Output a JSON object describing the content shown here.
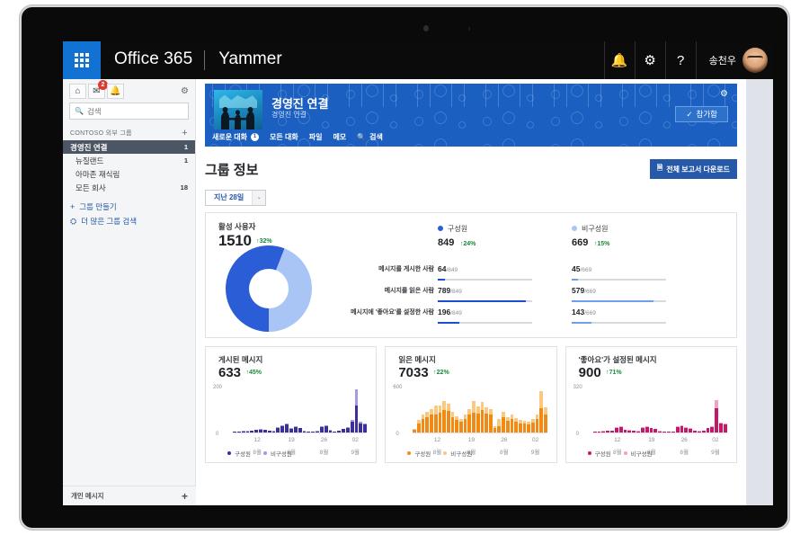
{
  "suite": {
    "waffle": "app-launcher",
    "brand": "Office 365",
    "app": "Yammer",
    "bell_icon": "✉",
    "notifications_icon": "🔔",
    "settings_icon": "⚙",
    "help_icon": "?",
    "user_name": "송천우"
  },
  "leftnav": {
    "home_icon": "⌂",
    "inbox_icon": "✉",
    "bell_icon": "🔔",
    "inbox_badge": "2",
    "gear_icon": "⚙",
    "search": {
      "placeholder": "검색",
      "value": ""
    },
    "section_label": "CONTOSO 외부 그룹",
    "add_label": "+",
    "items": [
      {
        "label": "경영진 연결",
        "count": "1",
        "selected": true
      },
      {
        "label": "뉴질랜드",
        "count": "1",
        "selected": false
      },
      {
        "label": "아마존 재식림",
        "count": "",
        "selected": false
      },
      {
        "label": "모든 회사",
        "count": "18",
        "selected": false
      }
    ],
    "links": [
      {
        "icon": "+",
        "label": "그룹 만들기"
      },
      {
        "icon": "⛭",
        "label": "더 많은 그룹 검색"
      }
    ],
    "bottom_label": "개인 메시지",
    "bottom_add": "+"
  },
  "group_banner": {
    "title": "경영진 연결",
    "subtitle": "경영진 연결",
    "join_label": "참가함",
    "join_check": "✓",
    "gear_icon": "⚙",
    "tabs": [
      {
        "label": "새로운 대화",
        "count": "1"
      },
      {
        "label": "모든 대화",
        "count": ""
      },
      {
        "label": "파일",
        "count": ""
      },
      {
        "label": "메모",
        "count": ""
      },
      {
        "label": "검색",
        "count": "",
        "icon": "🔍"
      }
    ]
  },
  "page": {
    "title": "그룹 정보",
    "download_label": "전체 보고서 다운로드",
    "download_icon": "🗎",
    "range_value": "지난 28일",
    "range_chevron": "⌄"
  },
  "chart_data": [
    {
      "type": "pie",
      "title": "활성 사용자",
      "total": "1510",
      "total_delta": "↑32%",
      "labels": [
        "구성원",
        "비구성원"
      ],
      "values": [
        849,
        669
      ],
      "colors": [
        "#2b5ed6",
        "#a8c5f5"
      ],
      "legend": [
        {
          "name": "구성원",
          "value": "849",
          "delta": "↑24%",
          "color": "#2b5ed6"
        },
        {
          "name": "비구성원",
          "value": "669",
          "delta": "↑15%",
          "color": "#a8c5f5"
        }
      ],
      "row_labels": [
        "메시지를 게시한 사람",
        "메시지를 읽은 사람",
        "메시지에 '좋아요'를 설정한 사람"
      ],
      "member_rows": [
        {
          "num": "64",
          "den": "/849",
          "pct": 7.5
        },
        {
          "num": "789",
          "den": "/849",
          "pct": 93
        },
        {
          "num": "196",
          "den": "/849",
          "pct": 23
        }
      ],
      "nonmember_rows": [
        {
          "num": "45",
          "den": "/669",
          "pct": 6.7
        },
        {
          "num": "579",
          "den": "/669",
          "pct": 86.5
        },
        {
          "num": "143",
          "den": "/669",
          "pct": 21.4
        }
      ]
    },
    {
      "type": "bar",
      "title": "게시된 메시지",
      "total": "633",
      "total_delta": "↑45%",
      "ylabel_max": "200",
      "ylabel_min": "0",
      "ylim": [
        0,
        200
      ],
      "xticks": [
        {
          "d1": "12",
          "d2": "8월"
        },
        {
          "d1": "19",
          "d2": "8월"
        },
        {
          "d1": "26",
          "d2": "8월"
        },
        {
          "d1": "02",
          "d2": "9월"
        }
      ],
      "legend": [
        {
          "name": "구성원",
          "color": "#3b2f9e"
        },
        {
          "name": "비구성원",
          "color": "#a39ce0"
        }
      ],
      "series": [
        {
          "name": "구성원",
          "color": "#3b2f9e",
          "values": [
            2,
            2,
            3,
            4,
            6,
            10,
            12,
            9,
            5,
            4,
            20,
            26,
            33,
            16,
            22,
            18,
            4,
            3,
            2,
            4,
            24,
            26,
            8,
            4,
            6,
            14,
            20,
            48,
            120,
            40,
            34
          ]
        },
        {
          "name": "비구성원",
          "color": "#a39ce0",
          "values": [
            0,
            0,
            1,
            1,
            1,
            2,
            2,
            1,
            1,
            1,
            3,
            4,
            5,
            2,
            3,
            2,
            1,
            0,
            0,
            1,
            4,
            4,
            1,
            0,
            1,
            2,
            3,
            6,
            72,
            6,
            4
          ]
        }
      ]
    },
    {
      "type": "bar",
      "title": "읽은 메시지",
      "total": "7033",
      "total_delta": "↑22%",
      "ylabel_max": "600",
      "ylabel_min": "0",
      "ylim": [
        0,
        600
      ],
      "xticks": [
        {
          "d1": "12",
          "d2": "8월"
        },
        {
          "d1": "19",
          "d2": "8월"
        },
        {
          "d1": "26",
          "d2": "8월"
        },
        {
          "d1": "02",
          "d2": "9월"
        }
      ],
      "legend": [
        {
          "name": "구성원",
          "color": "#f08a15"
        },
        {
          "name": "비구성원",
          "color": "#fac87e"
        }
      ],
      "series": [
        {
          "name": "구성원",
          "color": "#f08a15",
          "values": [
            30,
            120,
            170,
            200,
            230,
            240,
            260,
            290,
            280,
            200,
            160,
            140,
            180,
            230,
            260,
            250,
            290,
            250,
            240,
            60,
            80,
            200,
            150,
            170,
            140,
            120,
            110,
            100,
            130,
            180,
            320,
            240
          ]
        },
        {
          "name": "비구성원",
          "color": "#fac87e",
          "values": [
            10,
            40,
            60,
            70,
            80,
            110,
            90,
            120,
            100,
            70,
            50,
            40,
            60,
            80,
            160,
            90,
            110,
            80,
            70,
            20,
            100,
            70,
            50,
            60,
            50,
            40,
            40,
            35,
            40,
            60,
            230,
            90
          ]
        }
      ]
    },
    {
      "type": "bar",
      "title": "'좋아요'가 설정된 메시지",
      "total": "900",
      "total_delta": "↑71%",
      "ylabel_max": "320",
      "ylabel_min": "0",
      "ylim": [
        0,
        320
      ],
      "xticks": [
        {
          "d1": "12",
          "d2": "8월"
        },
        {
          "d1": "19",
          "d2": "8월"
        },
        {
          "d1": "26",
          "d2": "8월"
        },
        {
          "d1": "02",
          "d2": "9월"
        }
      ],
      "legend": [
        {
          "name": "구성원",
          "color": "#c4186b"
        },
        {
          "name": "비구성원",
          "color": "#f2a0c4"
        }
      ],
      "series": [
        {
          "name": "구성원",
          "color": "#c4186b",
          "values": [
            4,
            3,
            6,
            8,
            10,
            30,
            34,
            16,
            12,
            8,
            6,
            30,
            36,
            26,
            20,
            6,
            4,
            3,
            4,
            34,
            40,
            30,
            24,
            8,
            6,
            10,
            26,
            34,
            170,
            60,
            54
          ]
        },
        {
          "name": "비구성원",
          "color": "#f2a0c4",
          "values": [
            1,
            0,
            1,
            2,
            2,
            5,
            5,
            2,
            2,
            1,
            1,
            4,
            5,
            3,
            3,
            1,
            0,
            0,
            1,
            5,
            6,
            4,
            3,
            1,
            1,
            2,
            4,
            5,
            60,
            8,
            7
          ]
        }
      ]
    }
  ]
}
